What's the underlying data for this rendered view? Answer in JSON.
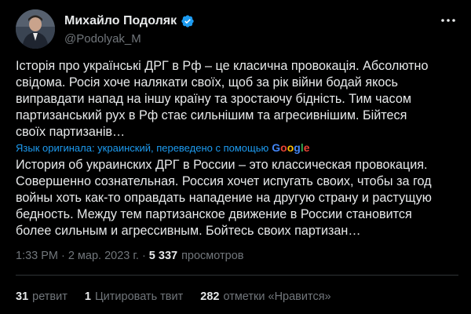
{
  "author": {
    "display_name": "Михайло Подоляк",
    "handle": "@Podolyak_M",
    "verified_icon": "verified-badge-icon",
    "avatar_icon": "avatar-photo"
  },
  "tweet": {
    "original_lines": [
      "Історія про українські ДРГ в Рф – це класична провокація. Абсолютно",
      "свідома. Росія хоче налякати своїх, щоб за рік війни бодай якось",
      "виправдати напад на іншу країну та зростаючу бідність. Тим часом",
      "партизанський рух в Рф стає сильнішим та агресивнішим. Бійтеся",
      "своїх партизанів…"
    ],
    "translation_label": "Язык оригинала: украинский, переведено с помощью",
    "translation_provider": "Google",
    "translated_lines": [
      "История об украинских ДРГ в России – это классическая провокация.",
      "Совершенно сознательная. Россия хочет испугать своих, чтобы за год",
      "войны хоть как-то оправдать нападение на другую страну и растущую",
      "бедность. Между тем партизанское движение в России становится",
      "более сильным и агрессивным. Бойтесь своих партизан…"
    ]
  },
  "meta": {
    "time": "1:33 PM",
    "separator": "·",
    "date": "2 мар. 2023 г.",
    "views_count": "5 337",
    "views_label": "просмотров"
  },
  "stats": {
    "retweets_count": "31",
    "retweets_label": "ретвит",
    "quotes_count": "1",
    "quotes_label": "Цитировать твит",
    "likes_count": "282",
    "likes_label": "отметки «Нравится»"
  },
  "colors": {
    "background": "#000000",
    "text": "#e7e9ea",
    "secondary": "#71767b",
    "link": "#1d9bf0",
    "divider": "#2f3336"
  }
}
